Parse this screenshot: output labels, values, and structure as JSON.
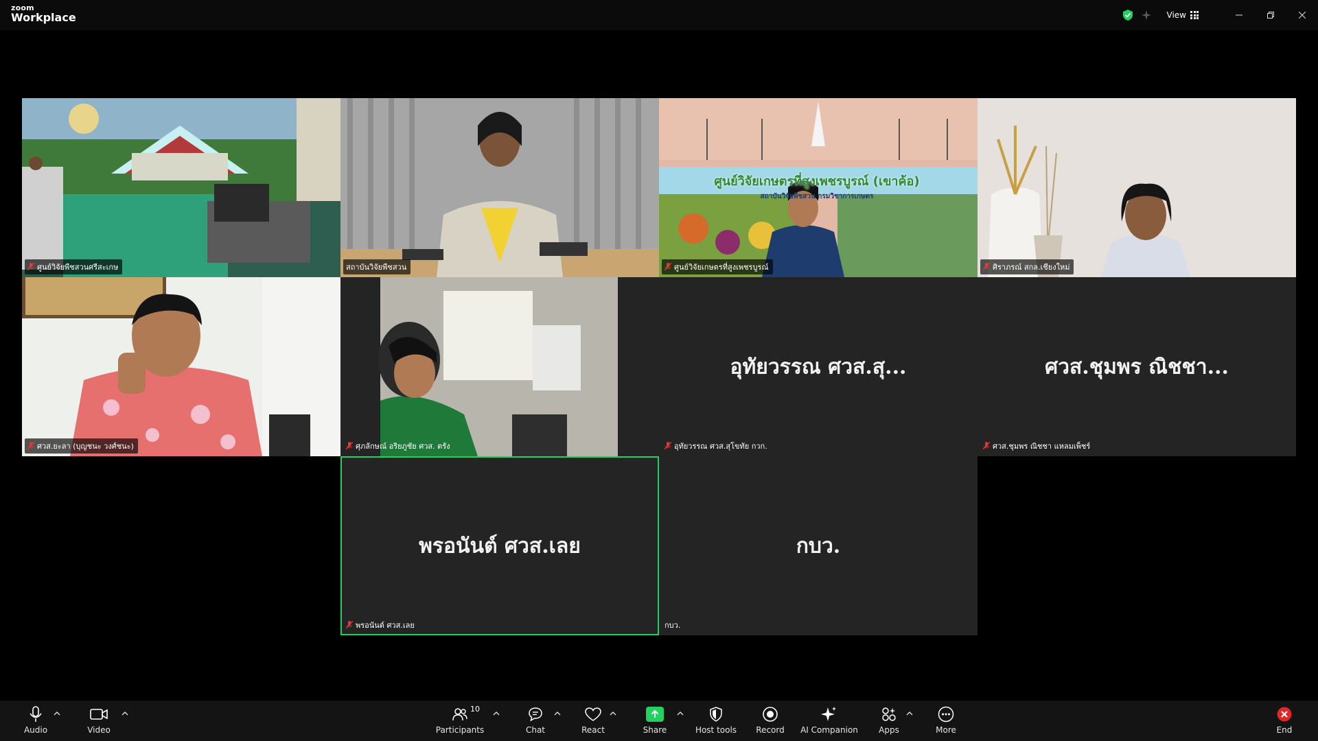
{
  "app": {
    "logo_top": "zoom",
    "logo_bottom": "Workplace",
    "view_label": "View"
  },
  "colors": {
    "active_speaker": "#23d160",
    "share_green": "#23d160",
    "end_red": "#e02828",
    "muted_red": "#e53935"
  },
  "tiles": [
    {
      "label": "ศูนย์วิจัยพืชสวนศรีสะเกษ",
      "muted": true,
      "type": "video"
    },
    {
      "label": "สถาบันวิจัยพืชสวน",
      "muted": false,
      "type": "video"
    },
    {
      "label": "ศูนย์วิจัยเกษตรที่สูงเพชรบูรณ์",
      "muted": true,
      "type": "video"
    },
    {
      "label": "ศิราภรณ์ สกล.เชียงใหม่",
      "muted": true,
      "type": "video"
    },
    {
      "label": "ศวส.ยะลา (บุญชนะ วงศ์ชนะ)",
      "muted": true,
      "type": "video"
    },
    {
      "label": "ศุภลักษณ์ อริยภูชัย ศวส. ตรัง",
      "muted": true,
      "type": "video"
    },
    {
      "label": "อุทัยวรรณ ศวส.สุโขทัย กวก.",
      "muted": true,
      "type": "name",
      "big": "อุทัยวรรณ ศวส.สุ..."
    },
    {
      "label": "ศวส.ชุมพร ณิชชา แหลมเพ็ชร์",
      "muted": true,
      "type": "name",
      "big": "ศวส.ชุมพร ณิชชา..."
    },
    {
      "label": "พรอนันต์ ศวส.เลย",
      "muted": true,
      "type": "name",
      "big": "พรอนันต์ ศวส.เลย",
      "active": true
    },
    {
      "label": "กบว.",
      "muted": false,
      "type": "name",
      "big": "กบว."
    }
  ],
  "scene_text": {
    "banner_title": "ศูนย์วิจัยเกษตรที่สูงเพชรบูรณ์ (เขาค้อ)",
    "banner_sub": "สถาบันวิจัยพืชสวน กรมวิชาการเกษตร"
  },
  "toolbar": {
    "audio": "Audio",
    "video": "Video",
    "participants": "Participants",
    "participants_count": "10",
    "chat": "Chat",
    "react": "React",
    "share": "Share",
    "host_tools": "Host tools",
    "record": "Record",
    "ai_companion": "AI Companion",
    "apps": "Apps",
    "more": "More",
    "end": "End"
  }
}
